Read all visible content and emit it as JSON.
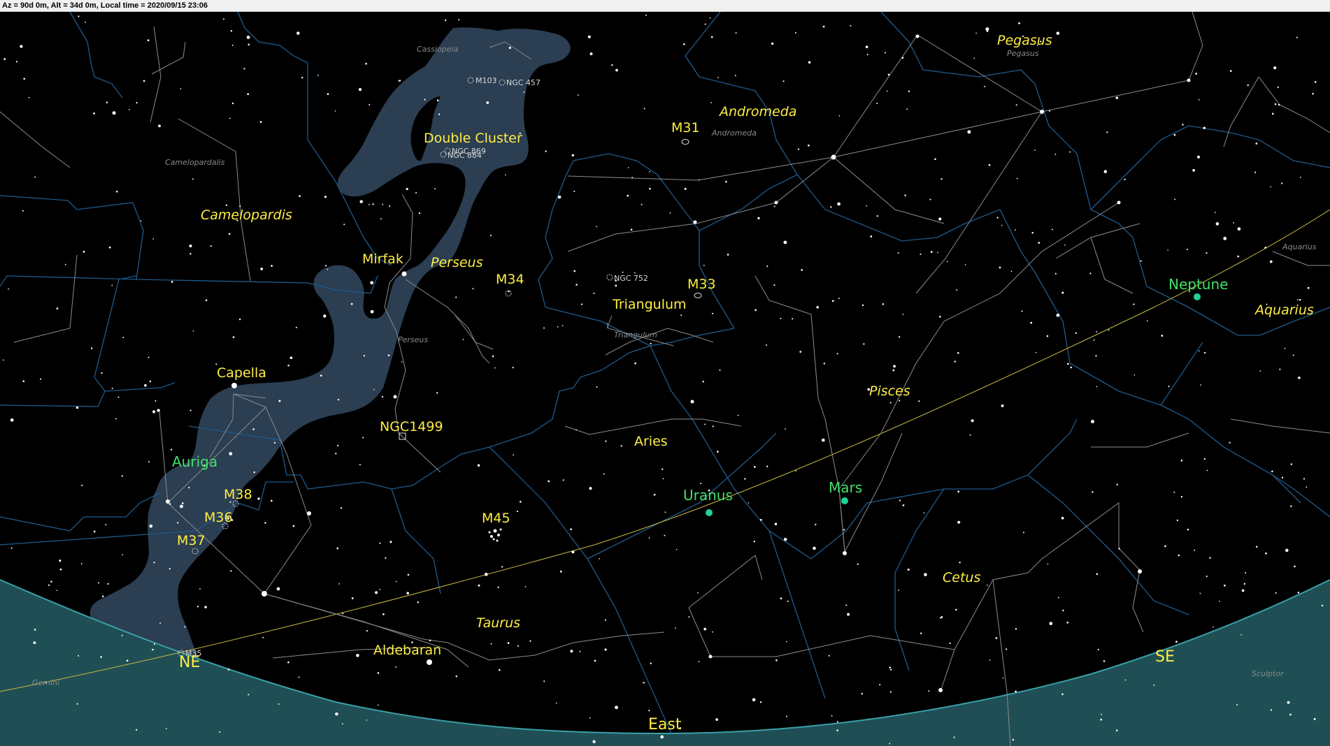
{
  "status_bar": {
    "text": "Az = 90d 0m, Alt = 34d 0m, Local time = 2020/09/15 23:06"
  },
  "colors": {
    "background": "#000000",
    "milky_way": "#2b3e52",
    "horizon": "#1f4f55",
    "constellation_lines": "#8c8c8c",
    "boundary_lines": "#1f5a8c",
    "ecliptic": "#c9b93e",
    "label_yellow": "#ffee44",
    "planet_green": "#1fd39a"
  },
  "constellations": [
    {
      "id": "pegasus",
      "name": "Pegasus"
    },
    {
      "id": "andromeda",
      "name": "Andromeda"
    },
    {
      "id": "camelopardis",
      "name": "Camelopardis"
    },
    {
      "id": "perseus",
      "name": "Perseus"
    },
    {
      "id": "pisces",
      "name": "Pisces"
    },
    {
      "id": "aquarius",
      "name": "Aquarius"
    },
    {
      "id": "cetus",
      "name": "Cetus"
    },
    {
      "id": "taurus",
      "name": "Taurus"
    }
  ],
  "constellation_small_names": [
    {
      "id": "cassiopeia",
      "name": "Cassiopeia"
    },
    {
      "id": "pegasus",
      "name": "Pegasus"
    },
    {
      "id": "andromeda",
      "name": "Andromeda"
    },
    {
      "id": "camelopardalis",
      "name": "Camelopardalis"
    },
    {
      "id": "perseus",
      "name": "Perseus"
    },
    {
      "id": "triangulum",
      "name": "Triangulum"
    },
    {
      "id": "aquarius",
      "name": "Aquarius"
    },
    {
      "id": "gemini",
      "name": "Gemini"
    },
    {
      "id": "sculptor",
      "name": "Sculptor"
    }
  ],
  "objects": [
    {
      "id": "double-cluster",
      "name": "Double Cluster"
    },
    {
      "id": "m31",
      "name": "M31"
    },
    {
      "id": "mirfak",
      "name": "Mirfak"
    },
    {
      "id": "m34",
      "name": "M34"
    },
    {
      "id": "m33",
      "name": "M33"
    },
    {
      "id": "triangulum",
      "name": "Triangulum"
    },
    {
      "id": "capella",
      "name": "Capella"
    },
    {
      "id": "ngc1499",
      "name": "NGC1499"
    },
    {
      "id": "auriga",
      "name": "Auriga"
    },
    {
      "id": "aries",
      "name": "Aries"
    },
    {
      "id": "m38",
      "name": "M38"
    },
    {
      "id": "m36",
      "name": "M36"
    },
    {
      "id": "m37",
      "name": "M37"
    },
    {
      "id": "m45",
      "name": "M45"
    },
    {
      "id": "aldebaran",
      "name": "Aldebaran"
    }
  ],
  "deep_sky_small": [
    {
      "id": "m103",
      "name": "M103"
    },
    {
      "id": "ngc457",
      "name": "NGC 457"
    },
    {
      "id": "ngc869",
      "name": "NGC 869"
    },
    {
      "id": "ngc884",
      "name": "NGC 884"
    },
    {
      "id": "ngc752",
      "name": "NGC 752"
    },
    {
      "id": "m35",
      "name": "M35"
    }
  ],
  "planets": [
    {
      "id": "neptune",
      "name": "Neptune"
    },
    {
      "id": "uranus",
      "name": "Uranus"
    },
    {
      "id": "mars",
      "name": "Mars"
    }
  ],
  "directions": [
    {
      "id": "ne",
      "name": "NE"
    },
    {
      "id": "east",
      "name": "East"
    },
    {
      "id": "se",
      "name": "SE"
    }
  ]
}
